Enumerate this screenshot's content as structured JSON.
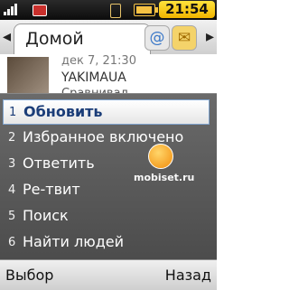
{
  "status": {
    "time": "21:54"
  },
  "header": {
    "title": "Домой",
    "icons": [
      "at-icon",
      "mail-icon"
    ]
  },
  "feed": {
    "meta": "дек 7, 21:30",
    "author": "YAKIMAUA",
    "snippet": "Сравнивал"
  },
  "menu": {
    "selected_index": 0,
    "items": [
      {
        "num": "1",
        "label": "Обновить"
      },
      {
        "num": "2",
        "label": "Избранное включено"
      },
      {
        "num": "3",
        "label": "Ответить"
      },
      {
        "num": "4",
        "label": "Ре-твит"
      },
      {
        "num": "5",
        "label": "Поиск"
      },
      {
        "num": "6",
        "label": "Найти людей"
      }
    ]
  },
  "watermark": {
    "text": "mobiset.ru"
  },
  "softkeys": {
    "left": "Выбор",
    "right": "Назад"
  }
}
